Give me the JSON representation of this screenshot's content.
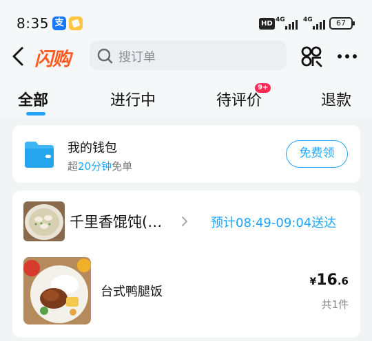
{
  "status_bar": {
    "time": "8:35",
    "alipay_glyph": "支",
    "hd": "HD",
    "sig1_label": "4G",
    "sig2_label": "4G",
    "battery": "67"
  },
  "header": {
    "logo": "闪购",
    "search_placeholder": "搜订单",
    "icons": [
      "back-arrow-icon",
      "search-icon",
      "scan-icon",
      "more-icon"
    ]
  },
  "tabs": [
    {
      "label": "全部",
      "active": true
    },
    {
      "label": "进行中"
    },
    {
      "label": "待评价",
      "badge": "9+"
    },
    {
      "label": "退款"
    }
  ],
  "wallet": {
    "title": "我的钱包",
    "subtitle_prefix": "超",
    "subtitle_highlight": "20分钟",
    "subtitle_suffix": "免单",
    "button": "免费领"
  },
  "order": {
    "store_name": "千里香馄饨(…",
    "eta": "预计08:49-09:04送达",
    "item_name": "台式鸭腿饭",
    "price_currency": "¥",
    "price_int": "16",
    "price_dec": ".6",
    "quantity": "共1件"
  },
  "colors": {
    "accent": "#1ea4ff",
    "logo": "#ff5a1f",
    "badge": "#ff2d55"
  }
}
